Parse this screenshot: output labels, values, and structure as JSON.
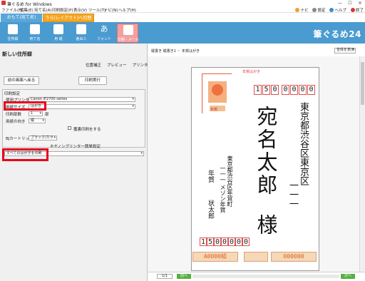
{
  "window": {
    "title": "筆ぐるめ for Windows",
    "minimize": "—",
    "maximize": "☐",
    "close": "✕"
  },
  "menu": [
    "ファイル(F)",
    "編集(E)",
    "宛て名(A)",
    "印刷設定(P)",
    "表示(V)",
    "ツール(T)",
    "ナビ(N)",
    "ヘルプ(H)"
  ],
  "top_links": {
    "navi": "ナビ",
    "settings": "設定",
    "help": "ヘルプ",
    "exit": "終了"
  },
  "mode_tabs": {
    "front": "おもて(宛て名)",
    "back": "うら(レイアウト)へ切替"
  },
  "toolbar": {
    "buttons": [
      "住所録",
      "宛て名",
      "用 紙",
      "差出人",
      "フォント",
      "印刷・メール"
    ],
    "brand": "筆ぐるめ24"
  },
  "panel": {
    "title": "新しい住所録",
    "subtabs": [
      "位置補正",
      "プレビュー",
      "プリンター設定"
    ],
    "back_button": "前の画面へ戻る",
    "print_button": "印刷実行",
    "print_settings_title": "印刷設定",
    "printer_label": "使用プリンター",
    "printer_value": "Canon iP2700 series",
    "paper_size_label": "用紙サイズ",
    "paper_size_value": "はがき",
    "copies_label": "印刷部数",
    "copies_value": "1",
    "copies_unit": "部",
    "orientation_label": "用紙の向き",
    "orientation_value": "縦",
    "duplex_label": "獲書印刷をする",
    "cartridge_label": "BJカートリッジ",
    "cartridge_value": "ブラック/カラー",
    "easy_setup_label": "キヤノンプリンター簡単設定",
    "print_target_value": "すべてのはがきを印刷"
  },
  "preview": {
    "breadcrumb": "縦書き 縦書き1 ・ 年賀はがき",
    "zoom_value": "全体を表示",
    "recipient_zip": [
      "1",
      "5",
      "0",
      "0",
      "0",
      "0",
      "0"
    ],
    "recipient_address_1": "東京都渋谷区東京区",
    "recipient_address_2": "一一一",
    "recipient_name": "宛名太郎",
    "recipient_honorific": "様",
    "sender_address_1": "東京都渋谷区年賀町",
    "sender_address_2": "一一一 メゾン年賀",
    "sender_name_1": "年賀",
    "sender_name_2": "状太郎",
    "sender_zip": [
      "1",
      "5",
      "0",
      "0",
      "0",
      "0",
      "0"
    ],
    "postcard_top_label": "年賀はがき",
    "stamp_label": "年賀",
    "lottery_left": "A0000組",
    "lottery_right": "000000"
  },
  "status": {
    "page": "1/1",
    "prev": "前へ",
    "next": "次へ"
  }
}
